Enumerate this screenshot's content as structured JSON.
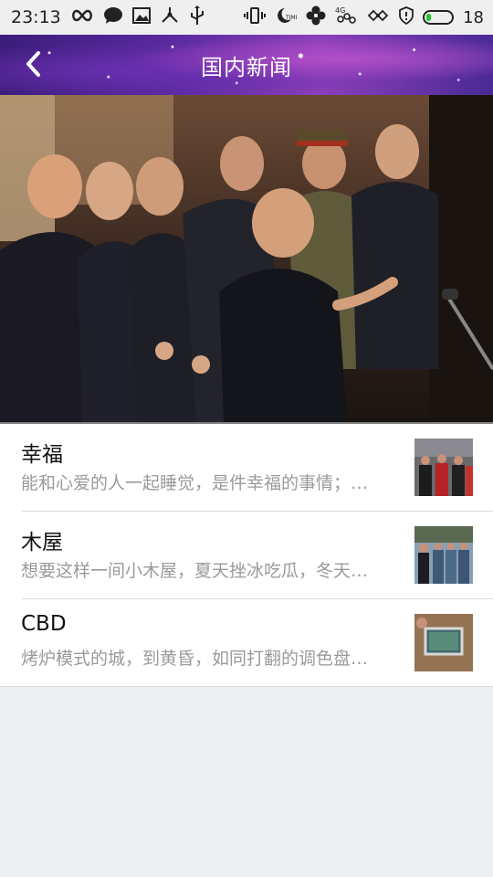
{
  "status_bar": {
    "time": "23:13",
    "battery_percent": "18",
    "battery_level": 0.18,
    "network_label": "4G",
    "left_icons": [
      "infinity-icon",
      "chat-bubble-icon",
      "image-icon",
      "usb-share-icon",
      "usb-icon"
    ],
    "right_icons": [
      "vibrate-icon",
      "moon-time-icon",
      "leaf-icon",
      "4g-signal-icon",
      "flower-icon",
      "shield-icon",
      "battery-icon"
    ]
  },
  "header": {
    "title": "国内新闻",
    "back_icon": "chevron-left-icon"
  },
  "hero": {
    "image_subject": "group photo"
  },
  "news": {
    "items": [
      {
        "title": "幸福",
        "summary": "能和心爱的人一起睡觉，是件幸福的事情；…"
      },
      {
        "title": "木屋",
        "summary": "想要这样一间小木屋，夏天挫冰吃瓜，冬天…"
      },
      {
        "title": "CBD",
        "summary": "烤炉模式的城，到黄昏，如同打翻的调色盘…"
      }
    ]
  },
  "colors": {
    "status_bar_bg": "#efefef",
    "header_purple": "#5a2aa0",
    "battery_green": "#1ec92f",
    "summary_gray": "#9a9a9a",
    "page_bg": "#eeeff3"
  }
}
